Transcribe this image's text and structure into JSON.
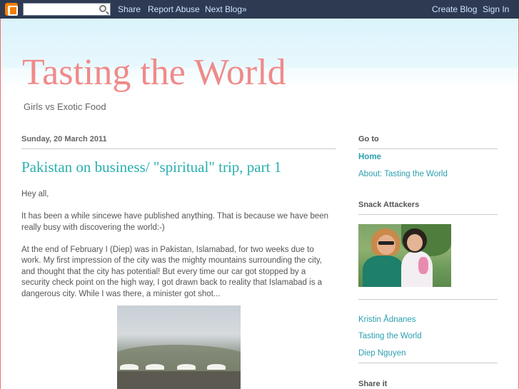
{
  "navbar": {
    "search_value": "",
    "share": "Share",
    "report_abuse": "Report Abuse",
    "next_blog": "Next Blog»",
    "create_blog": "Create Blog",
    "sign_in": "Sign In"
  },
  "header": {
    "title": "Tasting the World",
    "description": "Girls vs Exotic Food"
  },
  "post": {
    "date": "Sunday, 20 March 2011",
    "title": "Pakistan on business/ \"spiritual\" trip, part 1",
    "paragraphs": [
      "Hey all,",
      "It has been a while sincewe have published anything. That is because we have been really busy with discovering the world:-)",
      "At the end of February I (Diep) was in Pakistan, Islamabad, for two weeks due to work. My first impression of the city was the mighty mountains surrounding the city, and thought that the city has potential! But every time our car got stopped by a security check point on the high way, I got drawn back to reality that Islamabad is a dangerous city. While I was there, a minister got shot..."
    ]
  },
  "sidebar": {
    "goto_heading": "Go to",
    "goto_links": [
      "Home",
      "About: Tasting the World"
    ],
    "snack_heading": "Snack Attackers",
    "people": [
      "Kristin Ådnanes",
      "Tasting the World",
      "Diep Nguyen"
    ],
    "share_heading": "Share it"
  },
  "colors": {
    "navbar": "#2d3a52",
    "title": "#f08a8a",
    "link": "#2b9fb0",
    "frame": "#f07070"
  }
}
